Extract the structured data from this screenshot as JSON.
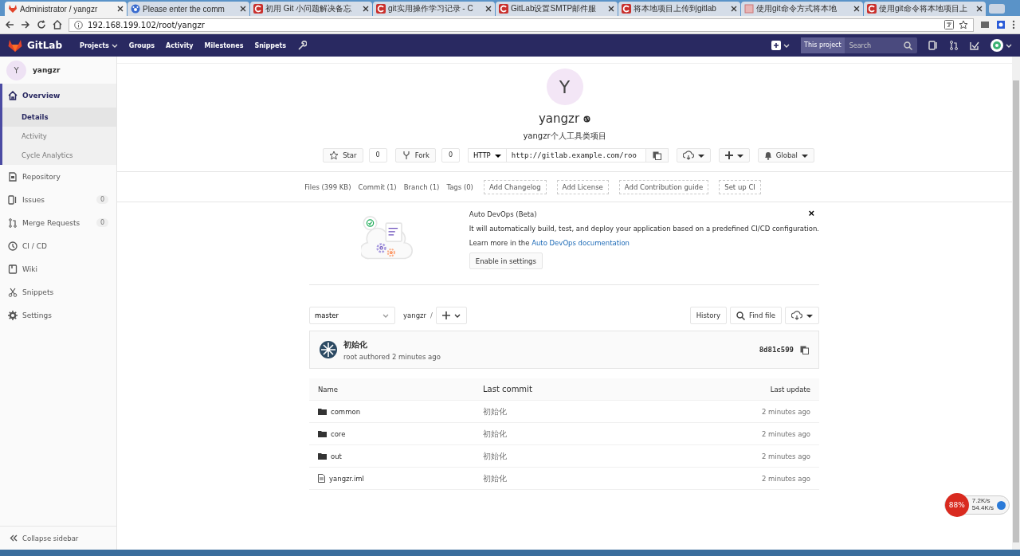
{
  "browser": {
    "tabs": [
      {
        "title": "Administrator / yangzr",
        "selected": true,
        "kind": "gitlab"
      },
      {
        "title": "Please enter the comm",
        "selected": false,
        "kind": "paw"
      },
      {
        "title": "初用 Git 小问题解决备忘",
        "selected": false,
        "kind": "csdn"
      },
      {
        "title": "git实用操作学习记录 - C",
        "selected": false,
        "kind": "csdn"
      },
      {
        "title": "GitLab设置SMTP邮件服",
        "selected": false,
        "kind": "csdn"
      },
      {
        "title": "将本地项目上传到gitlab",
        "selected": false,
        "kind": "csdn"
      },
      {
        "title": "使用git命令方式将本地",
        "selected": false,
        "kind": "page"
      },
      {
        "title": "使用git命令将本地项目上",
        "selected": false,
        "kind": "csdn"
      }
    ],
    "url": "192.168.199.102/root/yangzr"
  },
  "navbar": {
    "logo": "GitLab",
    "links": [
      {
        "label": "Projects",
        "dropdown": true
      },
      {
        "label": "Groups",
        "dropdown": false
      },
      {
        "label": "Activity",
        "dropdown": false
      },
      {
        "label": "Milestones",
        "dropdown": false
      },
      {
        "label": "Snippets",
        "dropdown": false
      }
    ],
    "search_scope": "This project",
    "search": {
      "placeholder": "Search"
    }
  },
  "sidebar": {
    "avatar": "Y",
    "project": "yangzr",
    "items": [
      {
        "label": "Overview",
        "kind": "home",
        "selected": true,
        "children": [
          {
            "label": "Details",
            "selected": true
          },
          {
            "label": "Activity",
            "selected": false
          },
          {
            "label": "Cycle Analytics",
            "selected": false
          }
        ]
      },
      {
        "label": "Repository",
        "kind": "repo",
        "selected": false
      },
      {
        "label": "Issues",
        "kind": "issues",
        "selected": false,
        "count": "0"
      },
      {
        "label": "Merge Requests",
        "kind": "merge",
        "selected": false,
        "count": "0"
      },
      {
        "label": "CI / CD",
        "kind": "ci",
        "selected": false
      },
      {
        "label": "Wiki",
        "kind": "wiki",
        "selected": false
      },
      {
        "label": "Snippets",
        "kind": "snippets",
        "selected": false
      },
      {
        "label": "Settings",
        "kind": "settings",
        "selected": false
      }
    ],
    "collapse": "Collapse sidebar"
  },
  "project": {
    "avatar": "Y",
    "name": "yangzr",
    "description": "yangzr个人工具类项目",
    "star": {
      "label": "Star",
      "count": "0"
    },
    "fork": {
      "label": "Fork",
      "count": "0"
    },
    "protocol": "HTTP",
    "clone_url": "http://gitlab.example.com/roo",
    "notification": "Global"
  },
  "stats": [
    {
      "label": "Files (399 KB)",
      "kind": "link"
    },
    {
      "label": "Commit (1)",
      "kind": "link"
    },
    {
      "label": "Branch (1)",
      "kind": "link"
    },
    {
      "label": "Tags (0)",
      "kind": "link"
    },
    {
      "label": "Add Changelog",
      "kind": "dashed"
    },
    {
      "label": "Add License",
      "kind": "dashed"
    },
    {
      "label": "Add Contribution guide",
      "kind": "dashed"
    },
    {
      "label": "Set up CI",
      "kind": "dashed"
    }
  ],
  "auto_devops": {
    "title": "Auto DevOps (Beta)",
    "text": "It will automatically build, test, and deploy your application based on a predefined CI/CD configuration.",
    "learn_prefix": "Learn more in the",
    "learn_link": "Auto DevOps documentation",
    "button": "Enable in settings",
    "close": "×"
  },
  "repo_toolbar": {
    "branch": "master",
    "path": "yangzr",
    "separator": "/",
    "history": "History",
    "find_file": "Find file"
  },
  "last_commit": {
    "message": "初始化",
    "author_line": "root authored 2 minutes ago",
    "sha": "8d81c599"
  },
  "table": {
    "columns": [
      "Name",
      "Last commit",
      "Last update"
    ],
    "rows": [
      {
        "name": "common",
        "kind": "folder",
        "commit": "初始化",
        "updated": "2 minutes ago"
      },
      {
        "name": "core",
        "kind": "folder",
        "commit": "初始化",
        "updated": "2 minutes ago"
      },
      {
        "name": "out",
        "kind": "folder",
        "commit": "初始化",
        "updated": "2 minutes ago"
      },
      {
        "name": "yangzr.iml",
        "kind": "file",
        "commit": "初始化",
        "updated": "2 minutes ago"
      }
    ]
  },
  "net_monitor": {
    "percent": "88%",
    "up": "7.2K/s",
    "down": "54.4K/s"
  }
}
